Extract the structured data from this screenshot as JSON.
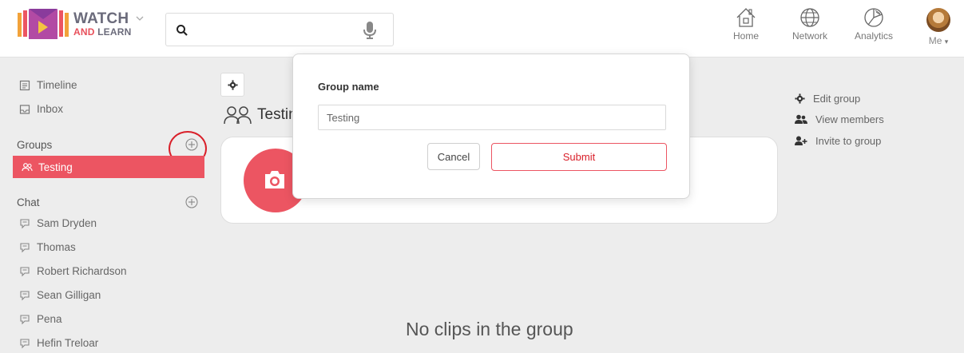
{
  "app": {
    "logo_line1": "WATCH",
    "logo_line2_accent": "AND",
    "logo_line2_rest": " LEARN"
  },
  "search": {
    "value": "",
    "placeholder": ""
  },
  "nav": {
    "home": "Home",
    "network": "Network",
    "analytics": "Analytics",
    "me": "Me"
  },
  "sidebar": {
    "top_items": [
      {
        "label": "Timeline",
        "icon": "timeline-icon"
      },
      {
        "label": "Inbox",
        "icon": "inbox-icon"
      }
    ],
    "groups_heading": "Groups",
    "active_group": "Testing",
    "chat_heading": "Chat",
    "chats": [
      "Sam Dryden",
      "Thomas",
      "Robert Richardson",
      "Sean Gilligan",
      "Pena",
      "Hefin Treloar"
    ]
  },
  "main": {
    "group_title": "Testing",
    "no_clips": "No clips in the group",
    "right_menu": [
      "Edit group",
      "View members",
      "Invite to group"
    ]
  },
  "modal": {
    "label": "Group name",
    "input_value": "Testing",
    "cancel": "Cancel",
    "submit": "Submit"
  },
  "colors": {
    "accent": "#ec5562",
    "highlight_circle": "#d9202a",
    "background": "#ededed"
  }
}
